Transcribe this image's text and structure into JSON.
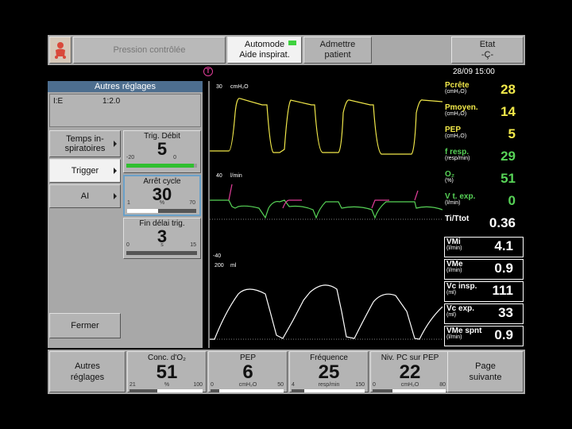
{
  "top": {
    "mode_label": "Pression contrôlée",
    "mode_btn_line1": "Automode",
    "mode_btn_line2": "Aide inspirat.",
    "admit_line1": "Admettre",
    "admit_line2": "patient",
    "status_line1": "Etat",
    "status_line2": "-Ç-"
  },
  "trigger_marker": "T",
  "datetime": "28/09  15:00",
  "left_panel": {
    "title": "Autres réglages",
    "ie_key": "I:E",
    "ie_value": "1:2.0",
    "menu": [
      {
        "label": "Temps in-\nspiratoires"
      },
      {
        "label": "Trigger"
      },
      {
        "label": "AI"
      }
    ],
    "close": "Fermer",
    "cards": [
      {
        "title": "Trig. Débit",
        "value": "5",
        "min": "-20",
        "max": "0",
        "unit": "",
        "level": 0.95,
        "fill_color": "#2fbf2f"
      },
      {
        "title": "Arrêt cycle",
        "value": "30",
        "min": "1",
        "max": "70",
        "unit": "%",
        "level": 0.45,
        "fill_color": "#ffffff"
      },
      {
        "title": "Fin délai trig.",
        "value": "3",
        "min": "0",
        "max": "15",
        "unit": "s",
        "level": 0.2,
        "fill_color": "#555555"
      }
    ]
  },
  "waves": {
    "p_top": "30",
    "p_unit": "cmH₂O",
    "f_top": "40",
    "f_unit": "l/min",
    "f_bot": "-40",
    "v_top": "200",
    "v_unit": "ml"
  },
  "numerics": [
    {
      "label": "Pcrête",
      "unit": "(cmH₂O)",
      "value": "28",
      "style": "yellow"
    },
    {
      "label": "Pmoyen.",
      "unit": "(cmH₂O)",
      "value": "14",
      "style": "yellow"
    },
    {
      "label": "PEP",
      "unit": "(cmH₂O)",
      "value": "5",
      "style": "yellow"
    },
    {
      "label": "f resp.",
      "unit": "(resp/min)",
      "value": "29",
      "style": "green"
    },
    {
      "label": "O₂",
      "unit": "(%)",
      "value": "51",
      "style": "green"
    },
    {
      "label": "V t. exp.",
      "unit": "(l/min)",
      "value": "0",
      "style": "green"
    },
    {
      "label": "Ti/Ttot",
      "unit": "",
      "value": "0.36",
      "style": "white"
    },
    {
      "label": "VMi",
      "unit": "(l/min)",
      "value": "4.1",
      "style": "boxed"
    },
    {
      "label": "VMe",
      "unit": "(l/min)",
      "value": "0.9",
      "style": "boxed"
    },
    {
      "label": "Vc insp.",
      "unit": "(ml)",
      "value": "111",
      "style": "boxed"
    },
    {
      "label": "Vc exp.",
      "unit": "(ml)",
      "value": "33",
      "style": "boxed"
    },
    {
      "label": "VMe spnt",
      "unit": "(l/min)",
      "value": "0.9",
      "style": "boxed"
    }
  ],
  "bottom": {
    "other_settings": "Autres\nréglages",
    "next_page": "Page\nsuivante",
    "cards": [
      {
        "title": "Conc. d'O₂",
        "value": "51",
        "min": "21",
        "max": "100",
        "unit": "%",
        "level": 0.38
      },
      {
        "title": "PEP",
        "value": "6",
        "min": "0",
        "max": "50",
        "unit": "cmH₂O",
        "level": 0.12
      },
      {
        "title": "Fréquence",
        "value": "25",
        "min": "4",
        "max": "150",
        "unit": "resp/min",
        "level": 0.17
      },
      {
        "title": "Niv. PC sur PEP",
        "value": "22",
        "min": "0",
        "max": "80",
        "unit": "cmH₂O",
        "level": 0.27
      }
    ]
  },
  "colors": {
    "pressure_wave": "#f1e84a",
    "flow_wave": "#57d357",
    "volume_wave": "#ffffff",
    "trigger_mark": "#e23e9a",
    "title_bar": "#4d6e8f"
  }
}
